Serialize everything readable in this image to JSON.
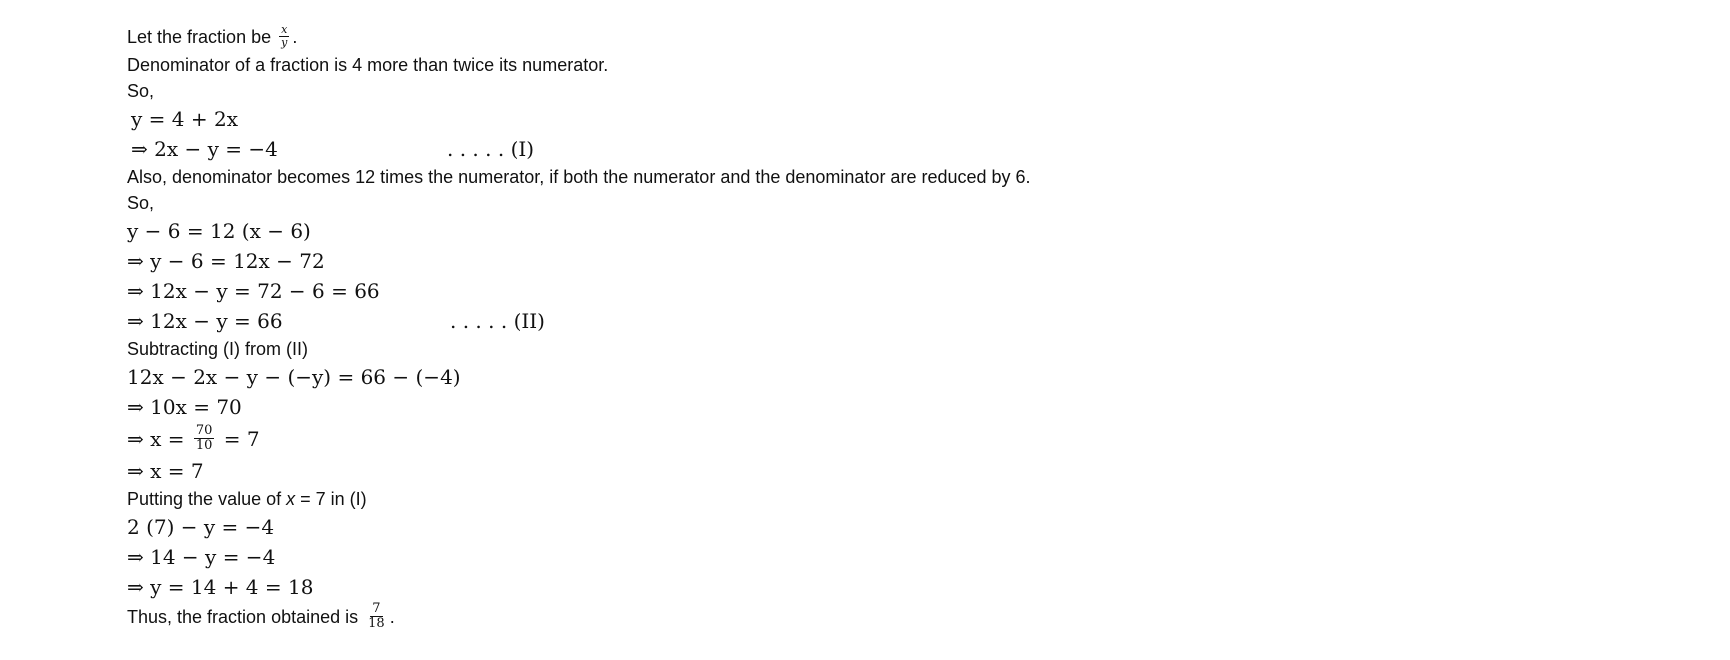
{
  "solution": {
    "intro_text": "Let the fraction be",
    "intro_frac": {
      "num": "x",
      "den": "y"
    },
    "intro_end": ".",
    "condition1": "Denominator of a fraction is 4 more than twice its numerator.",
    "so1": "So,",
    "eq1": "y = 4 + 2x",
    "eq2": "⇒ 2x − y = −4",
    "tag1": ". . . . . (I)",
    "condition2": "Also, denominator becomes 12 times the numerator, if both the numerator and the denominator are reduced by 6.",
    "so2": "So,",
    "eq3": "y − 6 = 12 (x − 6)",
    "eq4": "⇒ y − 6 = 12x − 72",
    "eq5": "⇒ 12x − y = 72 − 6 = 66",
    "eq6": "⇒ 12x − y = 66",
    "tag2": ". . . . . (II)",
    "subtract_text": "Subtracting (I) from (II)",
    "eq7": "12x − 2x − y − (−y) = 66 − (−4)",
    "eq8": "⇒ 10x = 70",
    "eq9_start": "⇒ x =",
    "eq9_frac": {
      "num": "70",
      "den": "10"
    },
    "eq9_end": "= 7",
    "eq10": "⇒ x = 7",
    "putting_start": "Putting the value of",
    "putting_var": "x",
    "putting_end": "= 7 in (I)",
    "eq11": "2 (7) − y = −4",
    "eq12": "⇒ 14 − y = −4",
    "eq13": "⇒ y = 14 + 4 = 18",
    "conclusion_text": "Thus, the fraction obtained is",
    "conclusion_frac": {
      "num": "7",
      "den": "18"
    },
    "conclusion_end": "."
  }
}
